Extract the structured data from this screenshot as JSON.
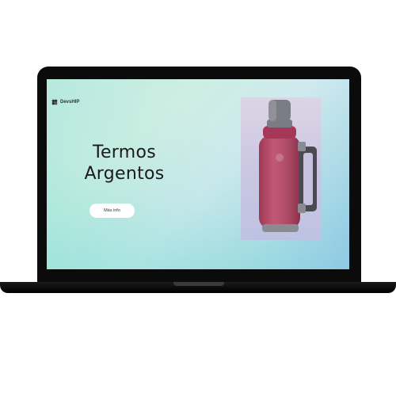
{
  "brand": {
    "name": "DevsHIP",
    "icon": "logo-icon"
  },
  "hero": {
    "title_line1": "Termos",
    "title_line2": "Argentos"
  },
  "cta": {
    "label": "Más info"
  },
  "product": {
    "image": "thermos-image",
    "color": "#b84062"
  }
}
